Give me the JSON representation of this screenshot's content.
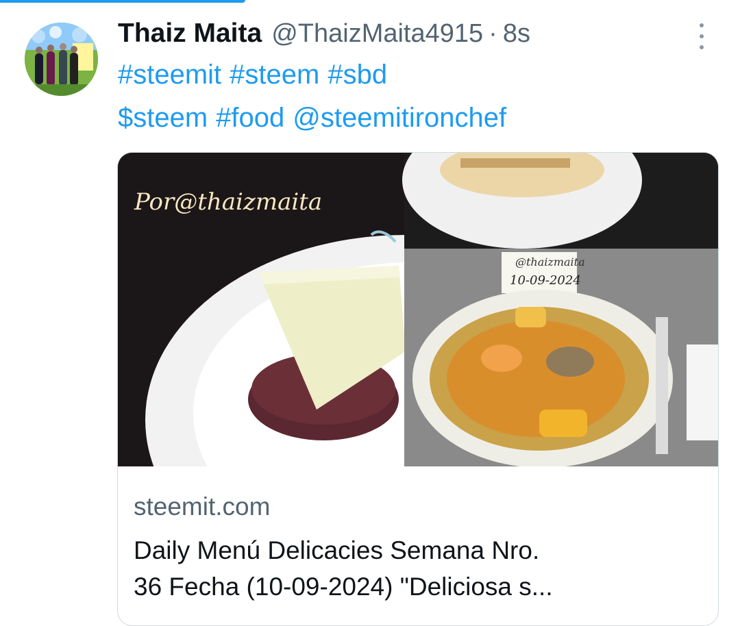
{
  "tweet": {
    "author_name": "Thaiz Maita",
    "author_handle": "@ThaizMaita4915",
    "separator": "·",
    "time": "8s",
    "tags_line1": [
      "#steemit",
      "#steem",
      "#sbd"
    ],
    "tags_line2": [
      "$steem",
      "#food",
      "@steemitironchef"
    ]
  },
  "card": {
    "image_left_caption": "Por@thaizmaita",
    "image_right_note_line1": "@thaizmaita",
    "image_right_note_line2": "10-09-2024",
    "domain": "steemit.com",
    "title_line1": "Daily Menú Delicacies Semana Nro.",
    "title_line2": "36 Fecha (10-09-2024) \"Deliciosa s..."
  },
  "icons": {
    "more": "more-vertical-icon"
  },
  "colors": {
    "accent": "#1d9bf0",
    "muted": "#536471",
    "text": "#0f1419"
  }
}
